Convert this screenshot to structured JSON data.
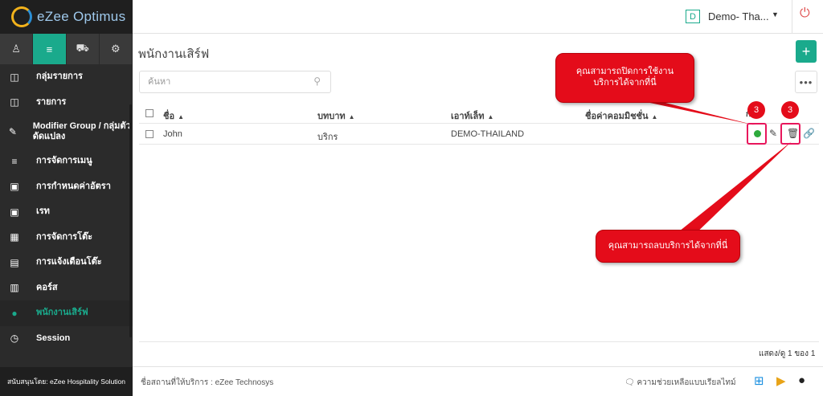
{
  "app": {
    "name": "eZee Optimus"
  },
  "sidebar": {
    "tabs": [
      {
        "icon": "user-icon",
        "glyph": "♙"
      },
      {
        "icon": "menu-list-icon",
        "glyph": "≡"
      },
      {
        "icon": "cart-icon",
        "glyph": "⛟"
      },
      {
        "icon": "gear-icon",
        "glyph": "⚙"
      }
    ],
    "items": [
      {
        "label": "กลุ่มรายการ",
        "glyph": "◫"
      },
      {
        "label": "รายการ",
        "glyph": "◫"
      },
      {
        "label": "Modifier Group / กลุ่มตัวดัดแปลง",
        "glyph": "✎"
      },
      {
        "label": "การจัดการเมนู",
        "glyph": "≡"
      },
      {
        "label": "การกำหนดค่าอัตรา",
        "glyph": "▣"
      },
      {
        "label": "เรท",
        "glyph": "▣"
      },
      {
        "label": "การจัดการโต๊ะ",
        "glyph": "▦"
      },
      {
        "label": "การแจ้งเตือนโต๊ะ",
        "glyph": "▤"
      },
      {
        "label": "คอร์ส",
        "glyph": "▥"
      },
      {
        "label": "พนักงานเสิร์ฟ",
        "glyph": "●"
      },
      {
        "label": "Session",
        "glyph": "◷"
      }
    ],
    "footer": "สนับสนุนโดย: eZee Hospitality Solution"
  },
  "topbar": {
    "property_initial": "D",
    "property_name": "Demo- Tha..."
  },
  "page": {
    "title": "พนักงานเสิร์ฟ",
    "add_glyph": "+",
    "search_placeholder": "ค้นหา",
    "more_glyph": "•••"
  },
  "table": {
    "columns": [
      "ชื่อ",
      "บทบาท",
      "เอาท์เล็ท",
      "ชื่อค่าคอมมิชชั่น",
      "การ"
    ],
    "rows": [
      {
        "name": "John",
        "role": "บริกร",
        "outlet": "DEMO-THAILAND",
        "commission": ""
      }
    ]
  },
  "pager": {
    "text": "แสดง/ดู 1 ของ 1"
  },
  "footer": {
    "left": "ชื่อสถานที่ให้บริการ : eZee Technosys",
    "help": "ความช่วยเหลือแบบเรียลไทม์"
  },
  "annotations": {
    "callout_top": "คุณสามารถปิดการใช้งานบริการได้จากที่นี่",
    "callout_bottom": "คุณสามารถลบบริการได้จากที่นี่",
    "badge_1": "3",
    "badge_2": "3"
  },
  "colors": {
    "accent": "#1aaa8c",
    "callout": "#e40c1a",
    "active_dot": "#2eaa3c"
  }
}
